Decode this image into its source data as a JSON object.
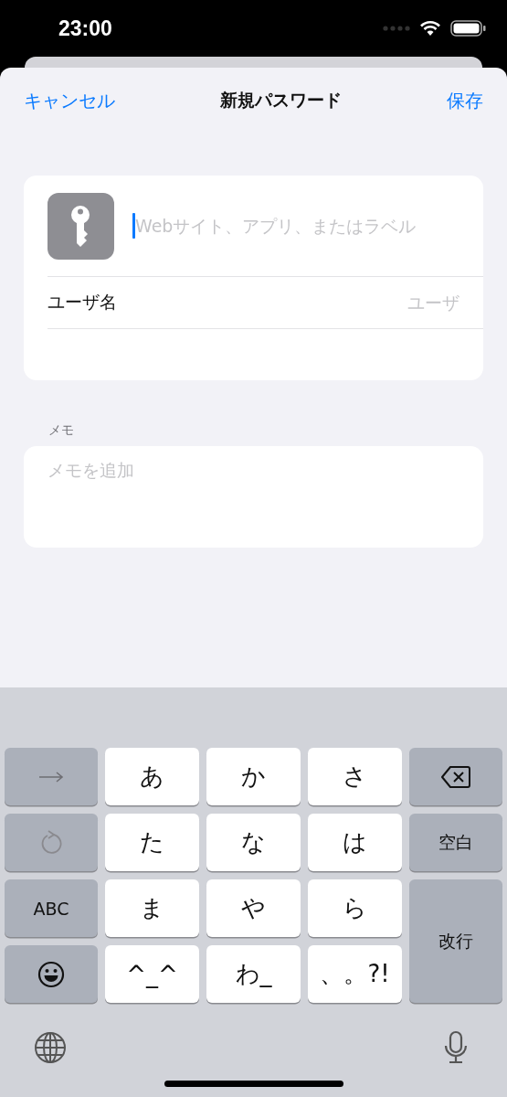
{
  "status_bar": {
    "time": "23:00"
  },
  "nav_bar": {
    "cancel": "キャンセル",
    "title": "新規パスワード",
    "save": "保存"
  },
  "login_card": {
    "website": {
      "placeholder": "Webサイト、アプリ、またはラベル"
    },
    "username": {
      "label": "ユーザ名",
      "placeholder": "ユーザ"
    }
  },
  "notes": {
    "header": "メモ",
    "placeholder": "メモを追加"
  },
  "keyboard": {
    "keys": [
      {
        "kind": "arrow"
      },
      {
        "kind": "letter",
        "label": "あ"
      },
      {
        "kind": "letter",
        "label": "か"
      },
      {
        "kind": "letter",
        "label": "さ"
      },
      {
        "kind": "backspace"
      },
      {
        "kind": "undo"
      },
      {
        "kind": "letter",
        "label": "た"
      },
      {
        "kind": "letter",
        "label": "な"
      },
      {
        "kind": "letter",
        "label": "は"
      },
      {
        "kind": "function",
        "label": "空白"
      },
      {
        "kind": "function",
        "label": "ABC"
      },
      {
        "kind": "letter",
        "label": "ま"
      },
      {
        "kind": "letter",
        "label": "や"
      },
      {
        "kind": "letter",
        "label": "ら"
      },
      {
        "kind": "return",
        "label": "改行"
      },
      {
        "kind": "emoji"
      },
      {
        "kind": "letter",
        "label": "^_^"
      },
      {
        "kind": "letter",
        "label": "わ_"
      },
      {
        "kind": "letter",
        "label": "、。?!"
      }
    ]
  }
}
